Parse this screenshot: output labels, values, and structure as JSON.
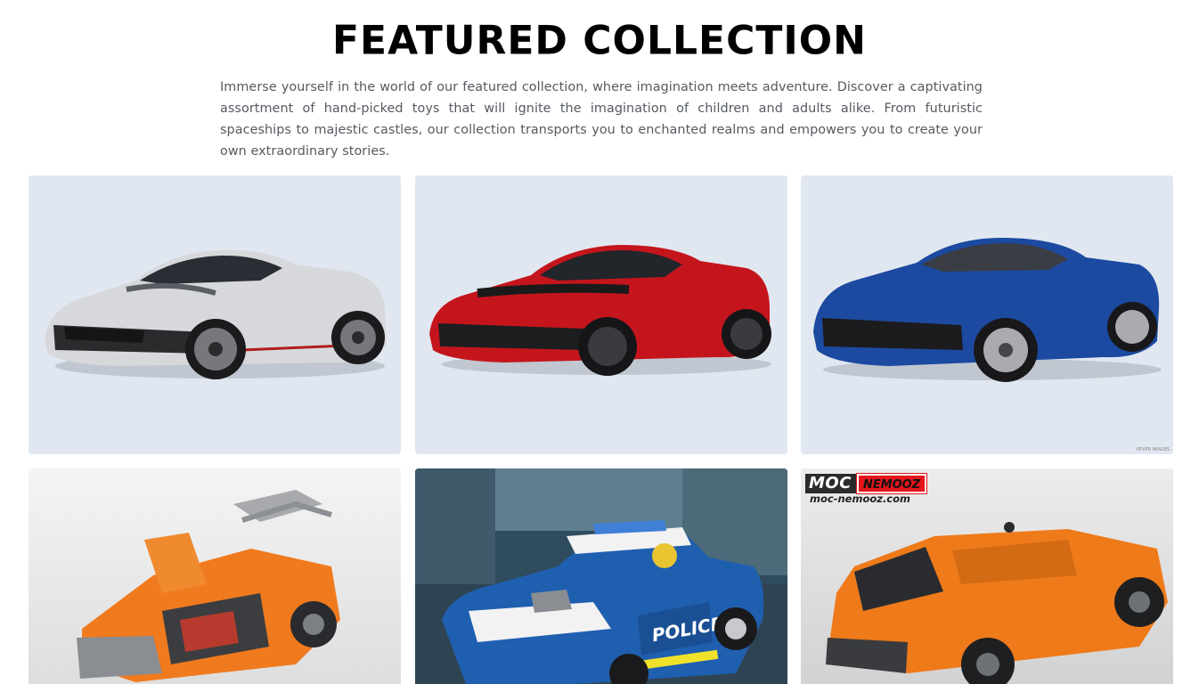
{
  "section": {
    "title": "FEATURED COLLECTION",
    "description": "Immerse yourself in the world of our featured collection, where imagination meets adventure. Discover a captivating assortment of hand-picked toys that will ignite the imagination of children and adults alike. From futuristic spaceships to majestic castles, our collection transports you to enchanted realms and empowers you to create your own extraordinary stories."
  },
  "gallery": {
    "items": [
      {
        "image": "white-sports-car-photo",
        "color": "#d9d9dc"
      },
      {
        "image": "red-sports-car-photo",
        "color": "#c4151c"
      },
      {
        "image": "blue-sports-car-photo",
        "color": "#1c4aa0",
        "watermark": "PEVER IMAGES"
      },
      {
        "image": "orange-technic-offroad-truck-photo",
        "color": "#f07a1e"
      },
      {
        "image": "blue-police-car-lego-set-photo",
        "color": "#1f5fb0",
        "badge": "POLICE"
      },
      {
        "image": "orange-technic-pickup-render",
        "color": "#ef7a1a",
        "logo_left": "MOC",
        "logo_right": "NEMOOZ",
        "logo_url": "moc-nemooz.com"
      }
    ]
  }
}
